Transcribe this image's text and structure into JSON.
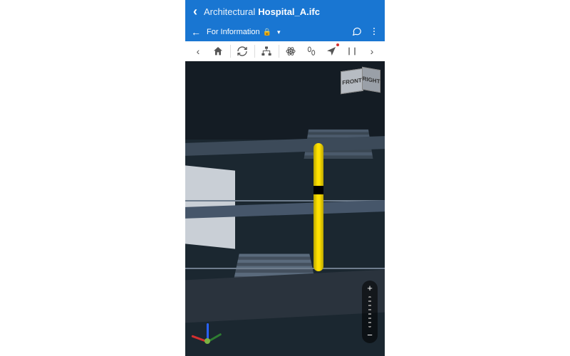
{
  "header": {
    "breadcrumb": "Architectural",
    "filename": "Hospital_A.ifc"
  },
  "subheader": {
    "status_label": "For Information",
    "lock_glyph": "🔒",
    "dropdown_glyph": "▾"
  },
  "toolbar": {
    "prev_glyph": "‹",
    "next_glyph": "›"
  },
  "viewcube": {
    "front_label": "FRONT",
    "right_label": "RIGHT"
  },
  "zoom": {
    "plus": "+",
    "minus": "−"
  },
  "colors": {
    "primary": "#1976d2",
    "highlight": "#ffe100"
  }
}
